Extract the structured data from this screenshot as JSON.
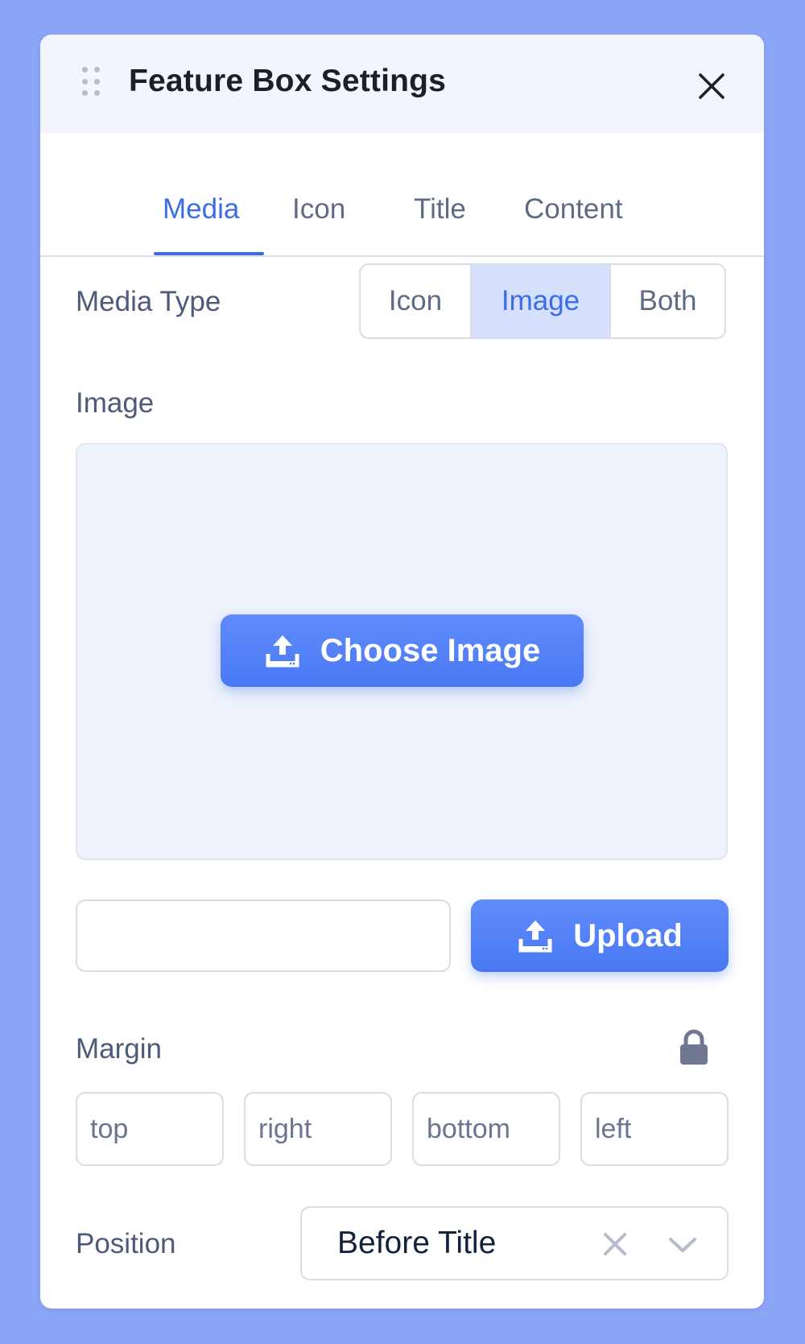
{
  "dialog": {
    "title": "Feature Box Settings",
    "icons": {
      "drag": "drag-handle-icon",
      "close": "close-icon"
    }
  },
  "tabs": [
    {
      "label": "Media",
      "active": true
    },
    {
      "label": "Icon",
      "active": false
    },
    {
      "label": "Title",
      "active": false
    },
    {
      "label": "Content",
      "active": false
    }
  ],
  "media_type": {
    "label": "Media Type",
    "options": [
      "Icon",
      "Image",
      "Both"
    ],
    "selected": "Image"
  },
  "image": {
    "label": "Image",
    "choose_button": "Choose Image",
    "url_value": "",
    "upload_button": "Upload",
    "icon": "upload-icon"
  },
  "margin": {
    "label": "Margin",
    "lock_icon": "lock-icon",
    "placeholders": {
      "top": "top",
      "right": "right",
      "bottom": "bottom",
      "left": "left"
    }
  },
  "position": {
    "label": "Position",
    "value": "Before Title",
    "icons": {
      "clear": "clear-icon",
      "dropdown": "chevron-down-icon"
    }
  },
  "colors": {
    "background": "#8ba6f7",
    "accent": "#3a6ee8",
    "selected_segment": "#d6e0fd",
    "header_bg": "#f2f5fb"
  }
}
